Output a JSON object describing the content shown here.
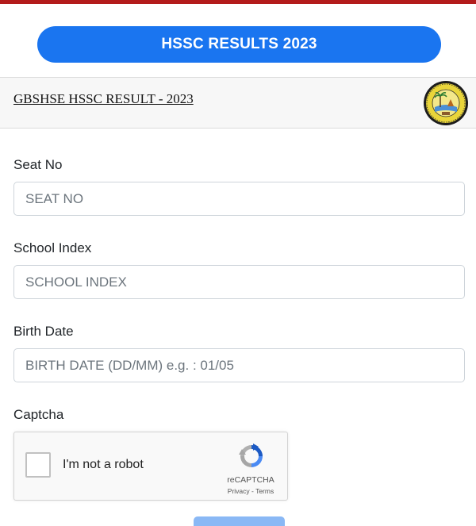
{
  "banner": {
    "title": "HSSC RESULTS 2023",
    "accent": "#1a75f0",
    "top_bar_color": "#b31b1b"
  },
  "header": {
    "title": "GBSHSE HSSC RESULT - 2023",
    "seal_icon": "board-seal-icon"
  },
  "form": {
    "seat_no": {
      "label": "Seat No",
      "placeholder": "SEAT NO",
      "value": ""
    },
    "school_index": {
      "label": "School Index",
      "placeholder": "SCHOOL INDEX",
      "value": ""
    },
    "birth_date": {
      "label": "Birth Date",
      "placeholder": "BIRTH DATE (DD/MM) e.g. : 01/05",
      "value": ""
    },
    "captcha": {
      "label": "Captcha",
      "checkbox_label": "I'm not a robot",
      "brand": "reCAPTCHA",
      "privacy": "Privacy",
      "separator": " - ",
      "terms": "Terms"
    }
  }
}
